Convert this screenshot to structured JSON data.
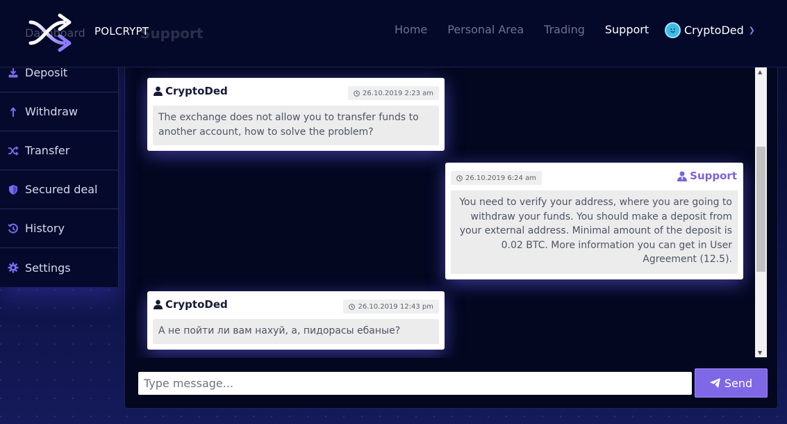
{
  "brand": {
    "name": "POLCRYPT",
    "ghost_title": "Support",
    "ghost_menu": "Dashboard"
  },
  "nav": [
    {
      "label": "Home"
    },
    {
      "label": "Personal Area"
    },
    {
      "label": "Trading"
    },
    {
      "label": "Support"
    }
  ],
  "user": {
    "name": "CryptoDed"
  },
  "sidebar": {
    "items": [
      {
        "label": "Deposit",
        "icon": "deposit-icon"
      },
      {
        "label": "Withdraw",
        "icon": "withdraw-icon"
      },
      {
        "label": "Transfer",
        "icon": "transfer-icon"
      },
      {
        "label": "Secured deal",
        "icon": "shield-icon"
      },
      {
        "label": "History",
        "icon": "history-icon"
      },
      {
        "label": "Settings",
        "icon": "gear-icon"
      }
    ]
  },
  "messages": [
    {
      "author": "CryptoDed",
      "time": "26.10.2019 2:23 am",
      "text": "The exchange does not allow you to transfer funds to another account, how to solve the problem?"
    },
    {
      "author": "Support",
      "time": "26.10.2019 6:24 am",
      "text": "You need to verify your address, where you are going to withdraw your funds. You should make a deposit from your external address. Minimal amount of the deposit is 0.02 BTC. More information you can get in User Agreement (12.5)."
    },
    {
      "author": "CryptoDed",
      "time": "26.10.2019 12:43 pm",
      "text": "А не пойти ли вам нахуй, а, пидорасы ебаные?"
    }
  ],
  "composer": {
    "placeholder": "Type message...",
    "send_label": "Send"
  },
  "colors": {
    "accent": "#7f68e6",
    "support": "#7b63d9",
    "background": "#0b1034"
  }
}
